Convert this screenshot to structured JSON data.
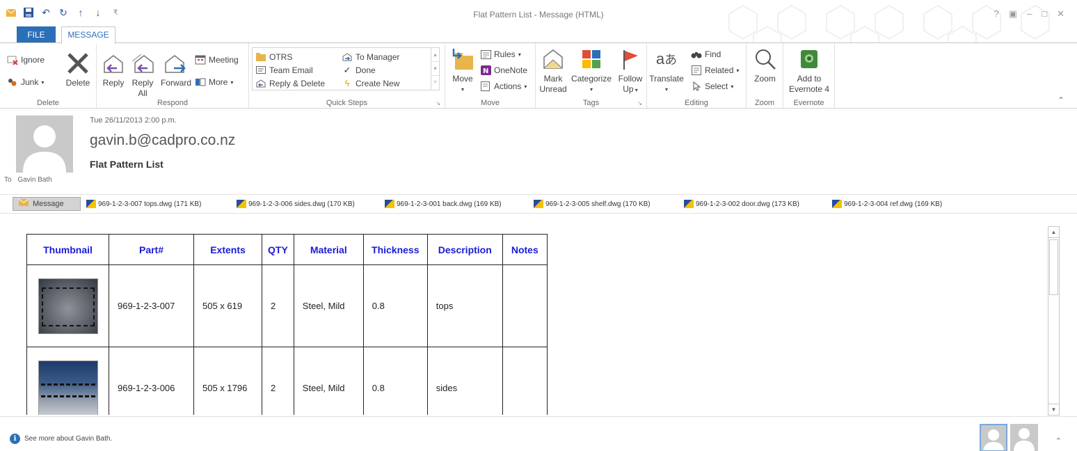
{
  "window": {
    "title": "Flat Pattern List - Message (HTML)",
    "controls": [
      "?",
      "▣",
      "–",
      "□",
      "✕"
    ]
  },
  "tabs": {
    "file": "FILE",
    "message": "MESSAGE"
  },
  "ribbon": {
    "delete": {
      "label": "Delete",
      "ignore": "Ignore",
      "junk": "Junk",
      "delete": "Delete"
    },
    "respond": {
      "label": "Respond",
      "reply": "Reply",
      "reply_all_1": "Reply",
      "reply_all_2": "All",
      "forward": "Forward",
      "meeting": "Meeting",
      "more": "More"
    },
    "quick_steps": {
      "label": "Quick Steps",
      "items": [
        "OTRS",
        "Team Email",
        "Reply & Delete",
        "To Manager",
        "Done",
        "Create New"
      ]
    },
    "move": {
      "label": "Move",
      "move": "Move",
      "rules": "Rules",
      "onenote": "OneNote",
      "actions": "Actions"
    },
    "tags": {
      "label": "Tags",
      "mark_1": "Mark",
      "mark_2": "Unread",
      "categorize": "Categorize",
      "follow_1": "Follow",
      "follow_2": "Up"
    },
    "editing": {
      "label": "Editing",
      "translate": "Translate",
      "find": "Find",
      "related": "Related",
      "select": "Select"
    },
    "zoom": {
      "label": "Zoom",
      "zoom": "Zoom"
    },
    "evernote": {
      "label": "Evernote",
      "add_1": "Add to",
      "add_2": "Evernote 4"
    }
  },
  "message": {
    "sent": "Tue 26/11/2013 2:00 p.m.",
    "from": "gavin.b@cadpro.co.nz",
    "subject": "Flat Pattern List",
    "to_label": "To",
    "to_name": "Gavin Bath"
  },
  "attachments": {
    "message_tab": "Message",
    "files": [
      "969-1-2-3-007 tops.dwg (171 KB)",
      "969-1-2-3-006 sides.dwg (170 KB)",
      "969-1-2-3-001 back.dwg (169 KB)",
      "969-1-2-3-005 shelf.dwg (170 KB)",
      "969-1-2-3-002 door.dwg (173 KB)",
      "969-1-2-3-004 ref.dwg (169 KB)"
    ]
  },
  "table": {
    "headers": [
      "Thumbnail",
      "Part#",
      "Extents",
      "QTY",
      "Material",
      "Thickness",
      "Description",
      "Notes"
    ],
    "rows": [
      {
        "part": "969-1-2-3-007",
        "extents": "505 x 619",
        "qty": "2",
        "material": "Steel, Mild",
        "thickness": "0.8",
        "description": "tops",
        "notes": ""
      },
      {
        "part": "969-1-2-3-006",
        "extents": "505 x 1796",
        "qty": "2",
        "material": "Steel, Mild",
        "thickness": "0.8",
        "description": "sides",
        "notes": ""
      }
    ]
  },
  "people_pane": {
    "see_more": "See more about Gavin Bath."
  },
  "colors": {
    "accent": "#2b6fb8",
    "header_text": "#1a1ad6"
  }
}
